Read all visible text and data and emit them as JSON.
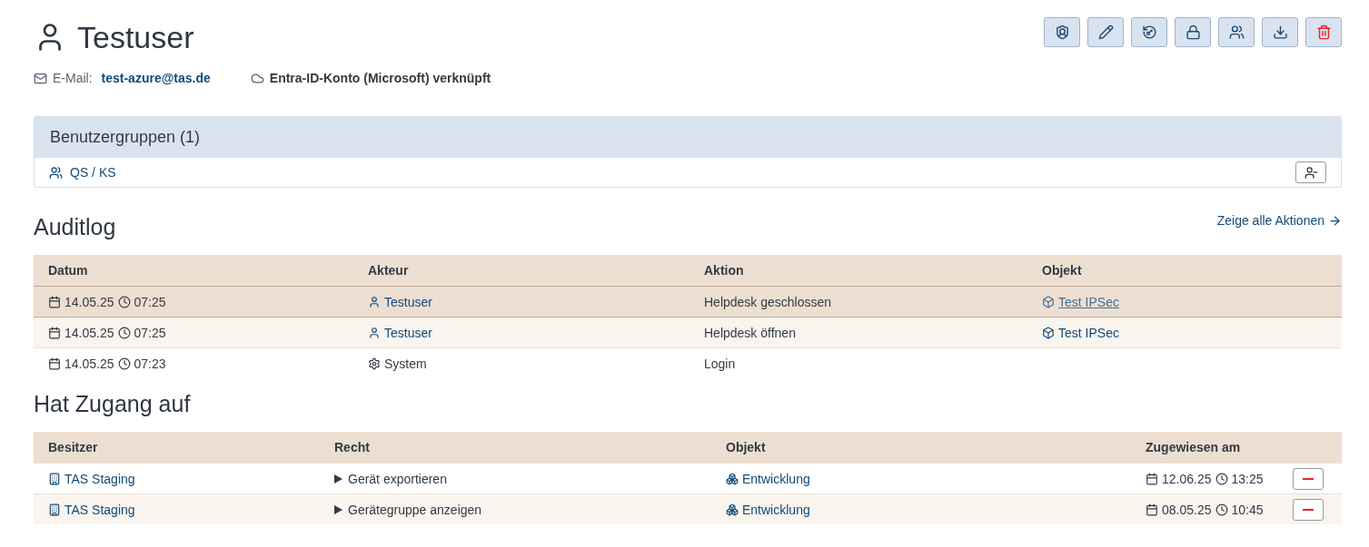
{
  "user": {
    "name": "Testuser",
    "email_label": "E-Mail:",
    "email": "test-azure@tas.de",
    "account": "Entra-ID-Konto (Microsoft) verknüpft"
  },
  "toolbar": [
    {
      "kind": "shield"
    },
    {
      "kind": "edit"
    },
    {
      "kind": "reset"
    },
    {
      "kind": "lock"
    },
    {
      "kind": "users"
    },
    {
      "kind": "download"
    },
    {
      "kind": "delete"
    }
  ],
  "groups": {
    "title": "Benutzergruppen (1)",
    "items": [
      {
        "name": "QS / KS"
      }
    ]
  },
  "auditlog": {
    "title": "Auditlog",
    "link": "Zeige alle Aktionen",
    "columns": [
      "Datum",
      "Akteur",
      "Aktion",
      "Objekt"
    ],
    "rows": [
      {
        "date": "14.05.25",
        "time": "07:25",
        "actor": "Testuser",
        "kind": "user",
        "action": "Helpdesk geschlossen",
        "object": "Test IPSec",
        "hovered": true
      },
      {
        "date": "14.05.25",
        "time": "07:25",
        "actor": "Testuser",
        "kind": "user",
        "action": "Helpdesk öffnen",
        "object": "Test IPSec",
        "hovered": false
      },
      {
        "date": "14.05.25",
        "time": "07:23",
        "actor": "System",
        "kind": "system",
        "action": "Login",
        "hovered": false
      }
    ]
  },
  "access": {
    "title": "Hat Zugang auf",
    "columns": [
      "Besitzer",
      "Recht",
      "Objekt",
      "Zugewiesen am"
    ],
    "rows": [
      {
        "owner": "TAS Staging",
        "right": "Gerät exportieren",
        "expanded": false,
        "object": "Entwicklung",
        "date": "12.06.25",
        "time": "13:25"
      },
      {
        "owner": "TAS Staging",
        "right": "Gerätegruppe anzeigen",
        "expanded": false,
        "object": "Entwicklung",
        "date": "08.05.25",
        "time": "10:45"
      }
    ]
  }
}
